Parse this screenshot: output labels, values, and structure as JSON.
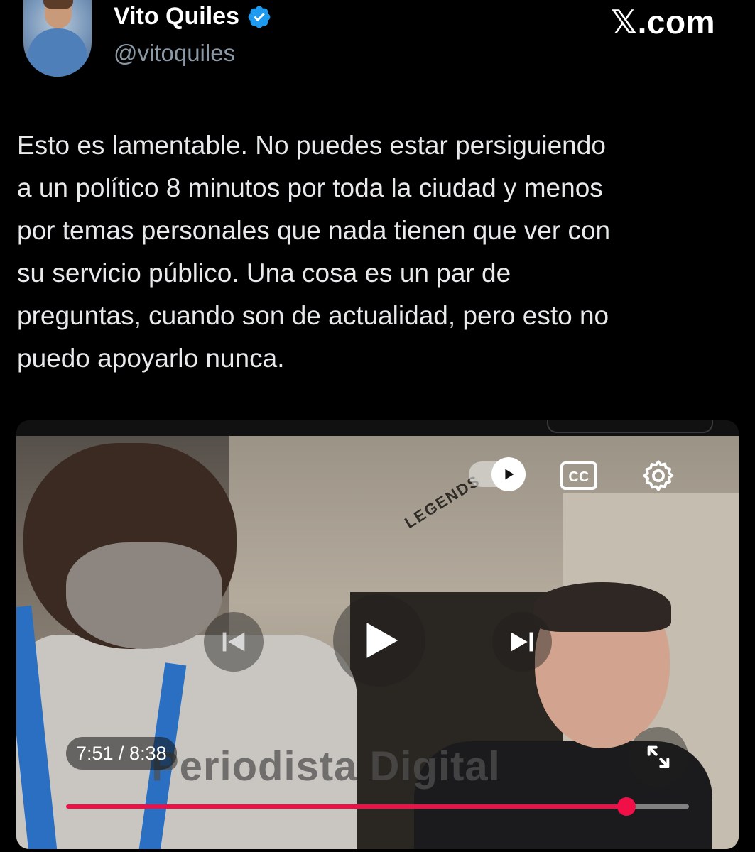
{
  "header": {
    "display_name": "Vito Quiles",
    "handle": "@vitoquiles",
    "brand": "𝕏.com",
    "verified_color": "#1d9bf0"
  },
  "tweet": {
    "text": "Esto es lamentable. No puedes estar  persiguiendo\na un político 8 minutos por toda la ciudad y menos\npor temas personales que nada tienen que ver con\nsu servicio público. Una cosa es un par de\npreguntas, cuando son de actualidad, pero esto no\npuedo apoyarlo nunca."
  },
  "video": {
    "watermark": "Periodista Digital",
    "store_sign": "LEGENDS",
    "time_display": "7:51 / 8:38",
    "progress": 0.9,
    "progress_color": "#f10f48",
    "controls": {
      "autoplay_icon": "autoplay-toggle-icon",
      "cc_label": "CC",
      "settings_icon": "gear-icon",
      "prev_icon": "skip-previous-icon",
      "play_icon": "play-icon",
      "next_icon": "skip-next-icon",
      "fullscreen_icon": "fullscreen-icon"
    }
  }
}
